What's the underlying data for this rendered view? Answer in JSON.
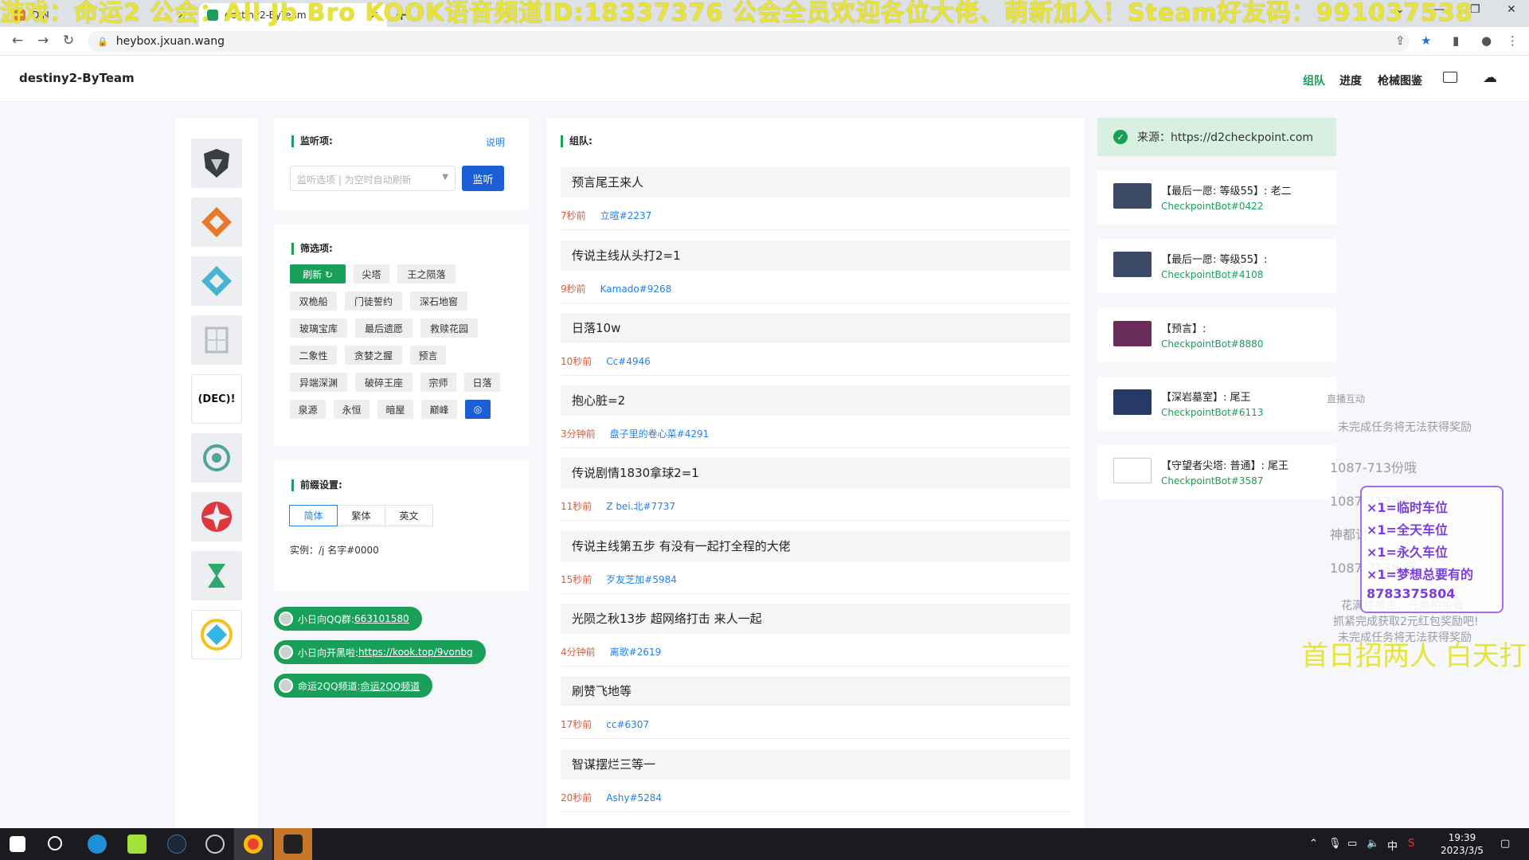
{
  "browser": {
    "tabs": [
      {
        "label": "DIN",
        "active": false
      },
      {
        "label": "destiny2-ByTeam",
        "active": true
      }
    ],
    "url": "heybox.jxuan.wang",
    "overlay_marquee": "游戏：命运2 公会：All Jb Bro KOOK语音频道ID:18337376 公会全员欢迎各位大佬、萌新加入！Steam好友码：991037538"
  },
  "header": {
    "brand": "destiny2-ByTeam",
    "nav": [
      "组队",
      "进度",
      "枪械图鉴"
    ],
    "active_nav": "组队"
  },
  "game_icons": [
    {
      "name": "shield-emblem-icon",
      "color": "#3a3d44"
    },
    {
      "name": "orange-diamond-icon",
      "color": "#e8792b"
    },
    {
      "name": "cyan-diamond-icon",
      "color": "#46b3d0"
    },
    {
      "name": "grey-emblem-icon",
      "color": "#b9bcc0"
    },
    {
      "name": "dec-text-icon",
      "label": "(DEC)!"
    },
    {
      "name": "teal-emblem-icon",
      "color": "#4fa59a"
    },
    {
      "name": "red-star-icon",
      "color": "#e0363e"
    },
    {
      "name": "green-hourglass-icon",
      "color": "#2ea96c"
    },
    {
      "name": "yellow-diamond-icon",
      "color": "#f4c21d"
    }
  ],
  "monitor": {
    "title": "监听项:",
    "help": "说明",
    "select_placeholder": "监听选项 | 为空时自动刷新",
    "button": "监听"
  },
  "filter": {
    "title": "筛选项:",
    "refresh": "刷新 ↻",
    "tags": [
      "尖塔",
      "王之陨落",
      "双桅船",
      "门徒誓约",
      "深石地窖",
      "玻璃宝库",
      "最后遗愿",
      "救赎花园",
      "二象性",
      "贪婪之握",
      "预言",
      "异端深渊",
      "破碎王座",
      "宗师",
      "日落",
      "泉源",
      "永恒",
      "暗屋",
      "巅峰"
    ],
    "gear": "◎"
  },
  "prefix": {
    "title": "前缀设置:",
    "langs": [
      "简体",
      "繁体",
      "英文"
    ],
    "active": "简体",
    "example": "实例：/j 名字#0000"
  },
  "links": [
    {
      "label": "小日向QQ群:",
      "link": "663101580"
    },
    {
      "label": "小日向开黑啦:",
      "link": "https://kook.top/9vonbg"
    },
    {
      "label": "命运2QQ频道:",
      "link": "命运2QQ频道"
    }
  ],
  "team": {
    "title": "组队:",
    "items": [
      {
        "title": "预言尾王来人",
        "time": "7秒前",
        "user": "立暄#2237"
      },
      {
        "title": "传说主线从头打2=1",
        "time": "9秒前",
        "user": "Kamado#9268"
      },
      {
        "title": "日落10w",
        "time": "10秒前",
        "user": "Cc#4946"
      },
      {
        "title": "抱心脏=2",
        "time": "3分钟前",
        "user": "盘子里的卷心菜#4291"
      },
      {
        "title": "传说剧情1830拿球2=1",
        "time": "11秒前",
        "user": "Z bei.北#7737"
      },
      {
        "title": "传说主线第五步 有没有一起打全程的大佬",
        "time": "15秒前",
        "user": "歹友芝加#5984"
      },
      {
        "title": "光陨之秋13步 超网络打击 来人一起",
        "time": "4分钟前",
        "user": "离歌#2619"
      },
      {
        "title": "刷赞飞地等",
        "time": "17秒前",
        "user": "cc#6307"
      },
      {
        "title": "智谋摆烂三等一",
        "time": "20秒前",
        "user": "Ashy#5284"
      }
    ]
  },
  "source": {
    "text": "来源：https://d2checkpoint.com"
  },
  "checkpoints": [
    {
      "title": "【最后一愿: 等级55】: 老二",
      "bot": "CheckpointBot#0422",
      "thumb": "#3b4a66"
    },
    {
      "title": "【最后一愿: 等级55】:",
      "bot": "CheckpointBot#4108",
      "thumb": "#3b4a66"
    },
    {
      "title": "【预言】:",
      "bot": "CheckpointBot#8880",
      "thumb": "#6a2c5a"
    },
    {
      "title": "【深岩墓室】: 尾王",
      "bot": "CheckpointBot#6113",
      "thumb": "#263a66"
    },
    {
      "title": "【守望者尖塔: 普通】: 尾王",
      "bot": "CheckpointBot#3587",
      "thumb": "#ffffff"
    }
  ],
  "stream_overlay": {
    "header": "直播互动",
    "lines": [
      "未完成任务将无法获得奖励",
      "1087-713份哦",
      "1087-713份哦",
      "神都讨",
      "1087-713份哦",
      "花满楼帮主，任务拍拍看",
      "抓紧完成获取2元红包奖励吧!",
      "未完成任务将无法获得奖励"
    ],
    "box_rows": [
      "×1=临时车位",
      "×1=全天车位",
      "×1=永久车位",
      "×1=梦想总要有的",
      "8783375804"
    ],
    "big": "首日招两人 白天打"
  },
  "taskbar": {
    "time": "19:39",
    "date": "2023/3/5",
    "ime": "中"
  }
}
